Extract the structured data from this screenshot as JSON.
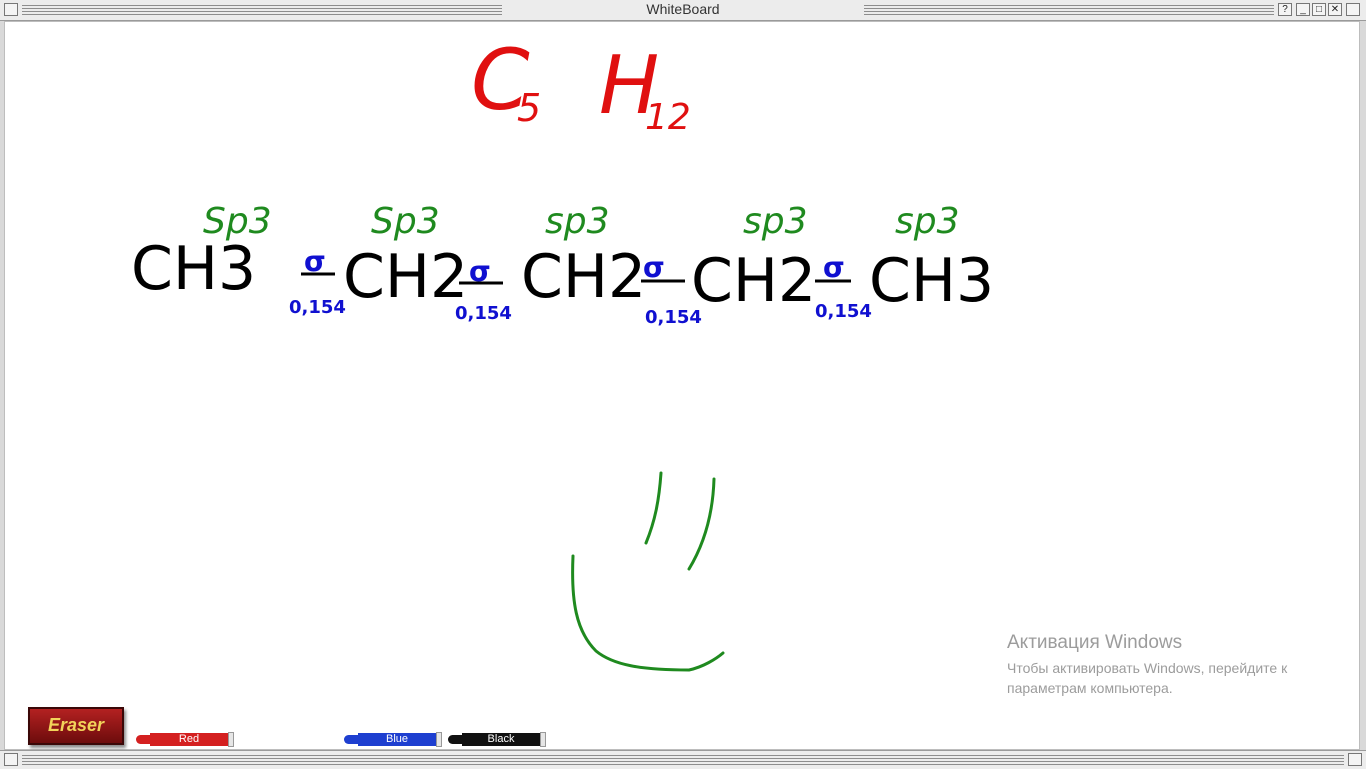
{
  "window": {
    "title": "WhiteBoard",
    "help_label": "?",
    "minimize_label": "_",
    "maximize_label": "□",
    "close_label": "✕"
  },
  "whiteboard": {
    "formula": {
      "c": "C",
      "c_sub": "5",
      "h": "H",
      "h_sub": "12",
      "color": "#e01010"
    },
    "hybridization": [
      "Sp3",
      "Sp3",
      "sp3",
      "sp3",
      "sp3"
    ],
    "hybridization_color": "#1f8a1f",
    "chain": [
      "CH3",
      "CH2",
      "CH2",
      "CH2",
      "CH3"
    ],
    "chain_color": "#000000",
    "bonds": [
      {
        "symbol": "σ",
        "length": "0,154"
      },
      {
        "symbol": "σ",
        "length": "0,154"
      },
      {
        "symbol": "σ",
        "length": "0,154"
      },
      {
        "symbol": "σ",
        "length": "0,154"
      }
    ],
    "bond_color": "#1010d0"
  },
  "watermark": {
    "title": "Активация Windows",
    "subtitle": "Чтобы активировать Windows, перейдите к параметрам компьютера."
  },
  "toolbar": {
    "eraser_label": "Eraser",
    "markers": [
      {
        "label": "Red",
        "color": "#d42020"
      },
      {
        "label": "Blue",
        "color": "#1e3fd0"
      },
      {
        "label": "Black",
        "color": "#111111"
      }
    ]
  }
}
